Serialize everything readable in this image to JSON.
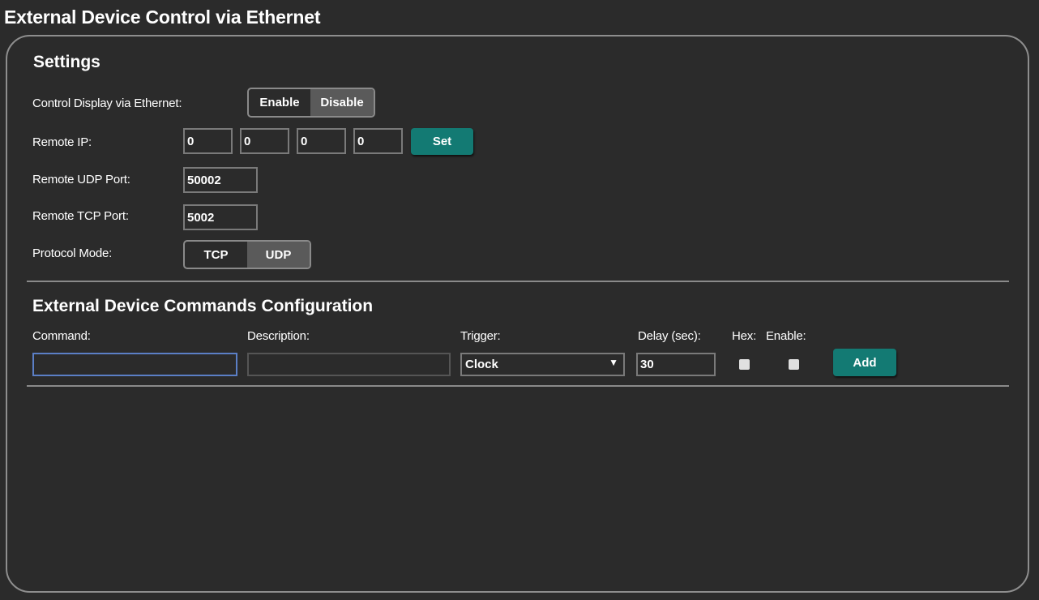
{
  "page": {
    "title": "External Device Control via Ethernet"
  },
  "settings": {
    "title": "Settings",
    "control_display": {
      "label": "Control Display via Ethernet:",
      "options": [
        "Enable",
        "Disable"
      ],
      "selected": "Disable"
    },
    "remote_ip": {
      "label": "Remote IP:",
      "octets": [
        "0",
        "0",
        "0",
        "0"
      ],
      "set_label": "Set"
    },
    "udp_port": {
      "label": "Remote UDP Port:",
      "value": "50002"
    },
    "tcp_port": {
      "label": "Remote TCP Port:",
      "value": "5002"
    },
    "protocol_mode": {
      "label": "Protocol Mode:",
      "options": [
        "TCP",
        "UDP"
      ],
      "selected": "UDP"
    }
  },
  "commands": {
    "title": "External Device Commands Configuration",
    "headers": {
      "command": "Command:",
      "description": "Description:",
      "trigger": "Trigger:",
      "delay": "Delay (sec):",
      "hex": "Hex:",
      "enable": "Enable:"
    },
    "row": {
      "command": "",
      "description": "",
      "trigger": "Clock",
      "delay": "30",
      "hex": false,
      "enable": false
    },
    "add_label": "Add"
  },
  "colors": {
    "background": "#2b2b2b",
    "accent": "#137a73",
    "border": "#8e8e8e"
  }
}
